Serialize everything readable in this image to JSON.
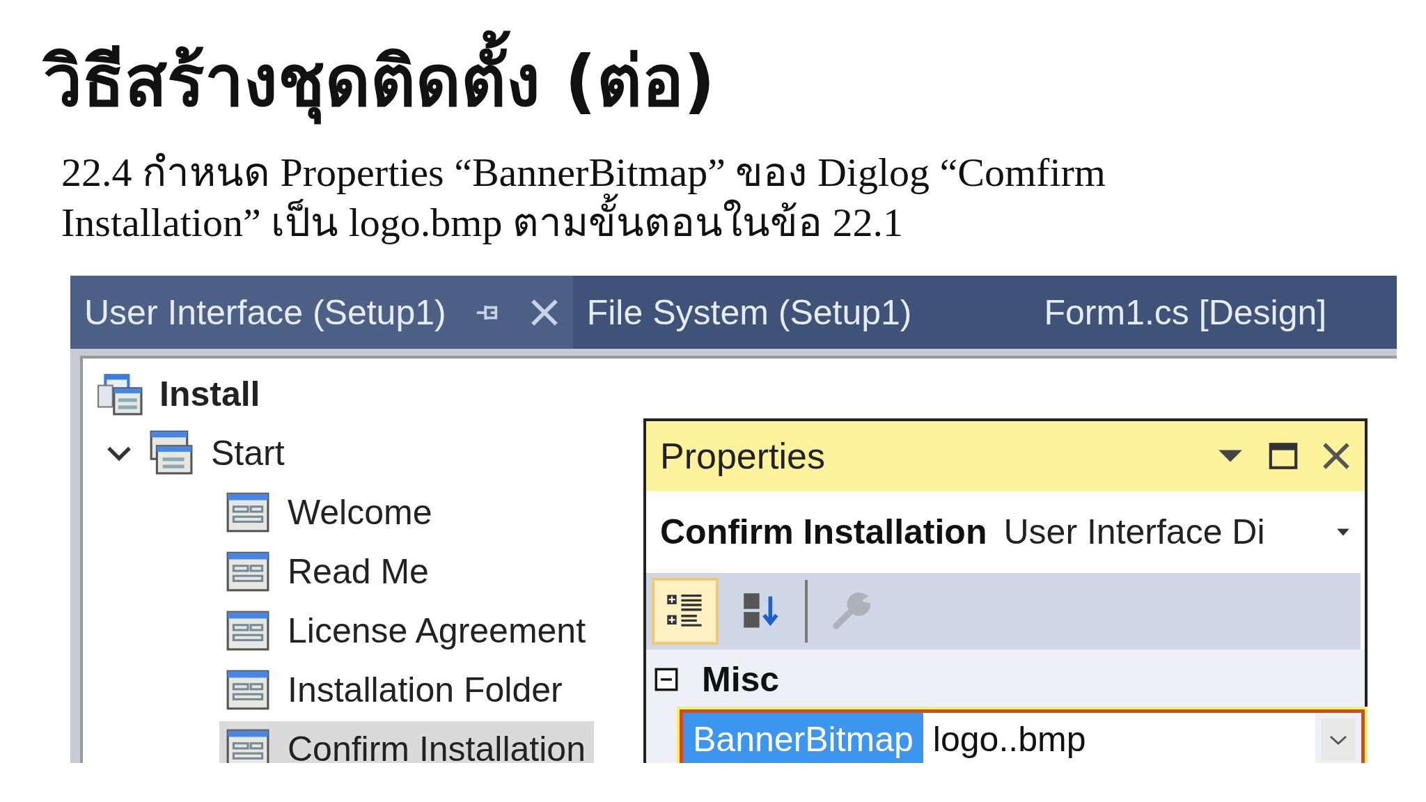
{
  "title": "วิธีสร้างชุดติดตั้ง (ต่อ)",
  "instruction": "22.4 กำหนด Properties “BannerBitmap” ของ Diglog “Comfirm Installation” เป็น logo.bmp ตามขั้นตอนในข้อ 22.1",
  "tabs": [
    {
      "label": "User Interface (Setup1)",
      "selected": true
    },
    {
      "label": "File System (Setup1)",
      "selected": false
    },
    {
      "label": "Form1.cs [Design]",
      "selected": false
    }
  ],
  "tree": [
    {
      "label": "Install",
      "kind": "root",
      "selected": false,
      "children": [
        {
          "label": "Start",
          "kind": "group",
          "expanded": true,
          "selected": false,
          "children": [
            {
              "label": "Welcome",
              "kind": "dialog",
              "selected": false
            },
            {
              "label": "Read Me",
              "kind": "dialog",
              "selected": false
            },
            {
              "label": "License Agreement",
              "kind": "dialog",
              "selected": false
            },
            {
              "label": "Installation Folder",
              "kind": "dialog",
              "selected": false
            },
            {
              "label": "Confirm Installation",
              "kind": "dialog",
              "selected": true
            }
          ]
        }
      ]
    }
  ],
  "properties": {
    "title": "Properties",
    "object_name": "Confirm Installation",
    "object_type": "User Interface Di",
    "toolbar": [
      {
        "kind": "categorized",
        "selected": true,
        "disabled": false
      },
      {
        "kind": "alphabetical",
        "selected": false,
        "disabled": false
      },
      {
        "kind": "property-pages",
        "selected": false,
        "disabled": true
      }
    ],
    "categories": [
      {
        "name": "Misc",
        "expanded": true,
        "rows": [
          {
            "name": "BannerBitmap",
            "value": "logo..bmp",
            "selected": true,
            "highlighted": true
          }
        ]
      }
    ]
  }
}
